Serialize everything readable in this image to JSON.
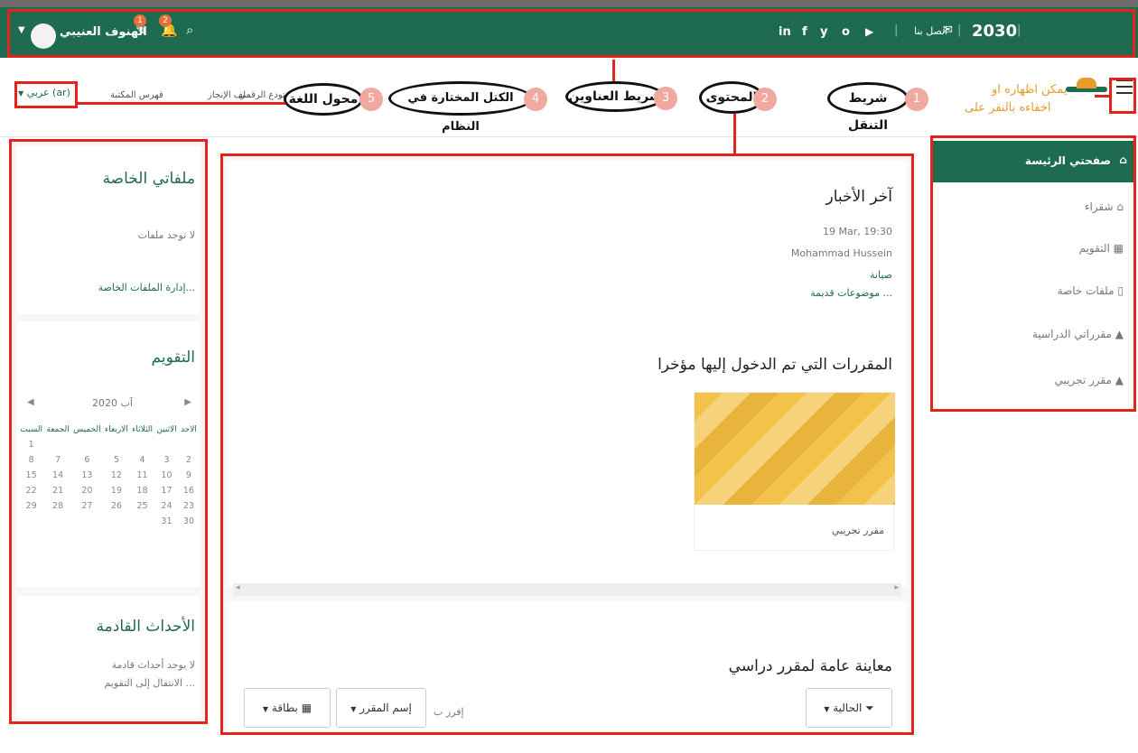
{
  "topbar": {
    "user_name": "الهنوف العنيبي",
    "msg_badge": "1",
    "notif_badge": "2",
    "contact_label": "اتصل بنا",
    "vision_label": "2030",
    "social": [
      "in",
      "f",
      "y",
      "o",
      "▶"
    ]
  },
  "subbar": {
    "lang_label": "عربي (ar)",
    "menu_links": [
      "ملف الإنجاز",
      "المستودع الرقمي",
      "فهرس المكتبة"
    ],
    "hint_text_1": "يمكن اظهاره او",
    "hint_text_2": "اخفاءه بالنقر على"
  },
  "annotations": {
    "n1": "1",
    "l1": "شريط التنقل",
    "n2": "2",
    "l2": "المحتوى",
    "n3": "3",
    "l3": "شريط العناوين",
    "n4": "4",
    "l4": "الكتل المختارة في النظام",
    "n5": "5",
    "l5": "محول اللغة"
  },
  "nav": {
    "home": "صفحتي الرئيسة",
    "items": [
      "شقراء",
      "التقويم",
      "ملفات خاصة",
      "مقرراتي الدراسية",
      "مقرر تجريبي"
    ]
  },
  "main": {
    "news_title": "آخر الأخبار",
    "news_date": "19 Mar, 19:30",
    "news_author": "Mohammad Hussein",
    "news_subject": "صيانة",
    "news_older": "موضوعات قديمة ...",
    "recent_title": "المقررات التي تم الدخول إليها مؤخرا",
    "course_name": "مقرر تجريبي",
    "overview_title": "معاينة عامة لمقرر دراسي",
    "filter_label": "الحالية",
    "sort_prefix": "إفرز ب",
    "sort_label": "إسم المقرر",
    "view_label": "بطاقة"
  },
  "blocks": {
    "files_title": "ملفاتي الخاصة",
    "files_empty": "لا توجد ملفات",
    "files_manage": "إدارة الملفات الخاصة...",
    "cal_title": "التقويم",
    "cal_month": "آب 2020",
    "cal_days": [
      "الاحد",
      "الاثنين",
      "الثلاثاء",
      "الاربعاء",
      "الخميس",
      "الجمعة",
      "السبت"
    ],
    "cal_rows": [
      [
        "",
        "",
        "",
        "",
        "",
        "",
        "1"
      ],
      [
        "2",
        "3",
        "4",
        "5",
        "6",
        "7",
        "8"
      ],
      [
        "9",
        "10",
        "11",
        "12",
        "13",
        "14",
        "15"
      ],
      [
        "16",
        "17",
        "18",
        "19",
        "20",
        "21",
        "22"
      ],
      [
        "23",
        "24",
        "25",
        "26",
        "27",
        "28",
        "29"
      ],
      [
        "30",
        "31",
        "",
        "",
        "",
        "",
        ""
      ]
    ],
    "events_title": "الأحداث القادمة",
    "events_empty": "لا يوجد أحداث قادمة",
    "events_link": "الانتقال إلى التقويم ..."
  },
  "colors": {
    "brand": "#1f6b52",
    "annotation": "#e3241b"
  }
}
